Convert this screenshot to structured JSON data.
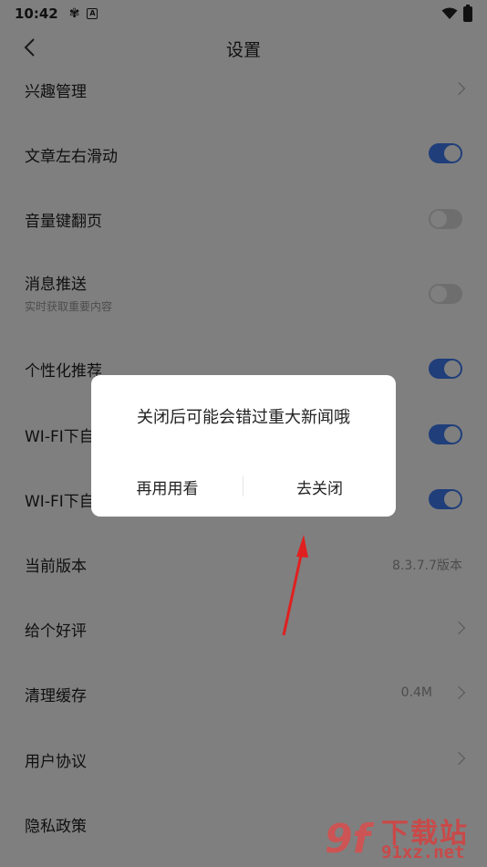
{
  "status_bar": {
    "time": "10:42"
  },
  "header": {
    "title": "设置"
  },
  "settings": [
    {
      "label": "兴趣管理",
      "control": "chevron"
    },
    {
      "label": "文章左右滑动",
      "control": "toggle",
      "on": true
    },
    {
      "label": "音量键翻页",
      "control": "toggle",
      "on": false
    },
    {
      "label": "消息推送",
      "sublabel": "实时获取重要内容",
      "control": "toggle",
      "on": false
    },
    {
      "label": "个性化推荐",
      "control": "toggle",
      "on": true
    },
    {
      "label": "WI-FI下自",
      "control": "toggle",
      "on": true
    },
    {
      "label": "WI-FI下自",
      "control": "toggle",
      "on": true
    },
    {
      "label": "当前版本",
      "control": "value",
      "value": "8.3.7.7版本"
    },
    {
      "label": "给个好评",
      "control": "chevron"
    },
    {
      "label": "清理缓存",
      "control": "value-chevron",
      "value": "0.4M"
    },
    {
      "label": "用户协议",
      "control": "chevron"
    },
    {
      "label": "隐私政策",
      "control": "none"
    }
  ],
  "dialog": {
    "message": "关闭后可能会错过重大新闻哦",
    "cancel_label": "再用用看",
    "confirm_label": "去关闭"
  },
  "watermark": {
    "logo": "9f",
    "brand": "下载站",
    "domain": "91xz.net"
  },
  "colors": {
    "toggle_on": "#3f7cf5",
    "toggle_off": "#dcdcdc",
    "arrow": "#e02020"
  }
}
